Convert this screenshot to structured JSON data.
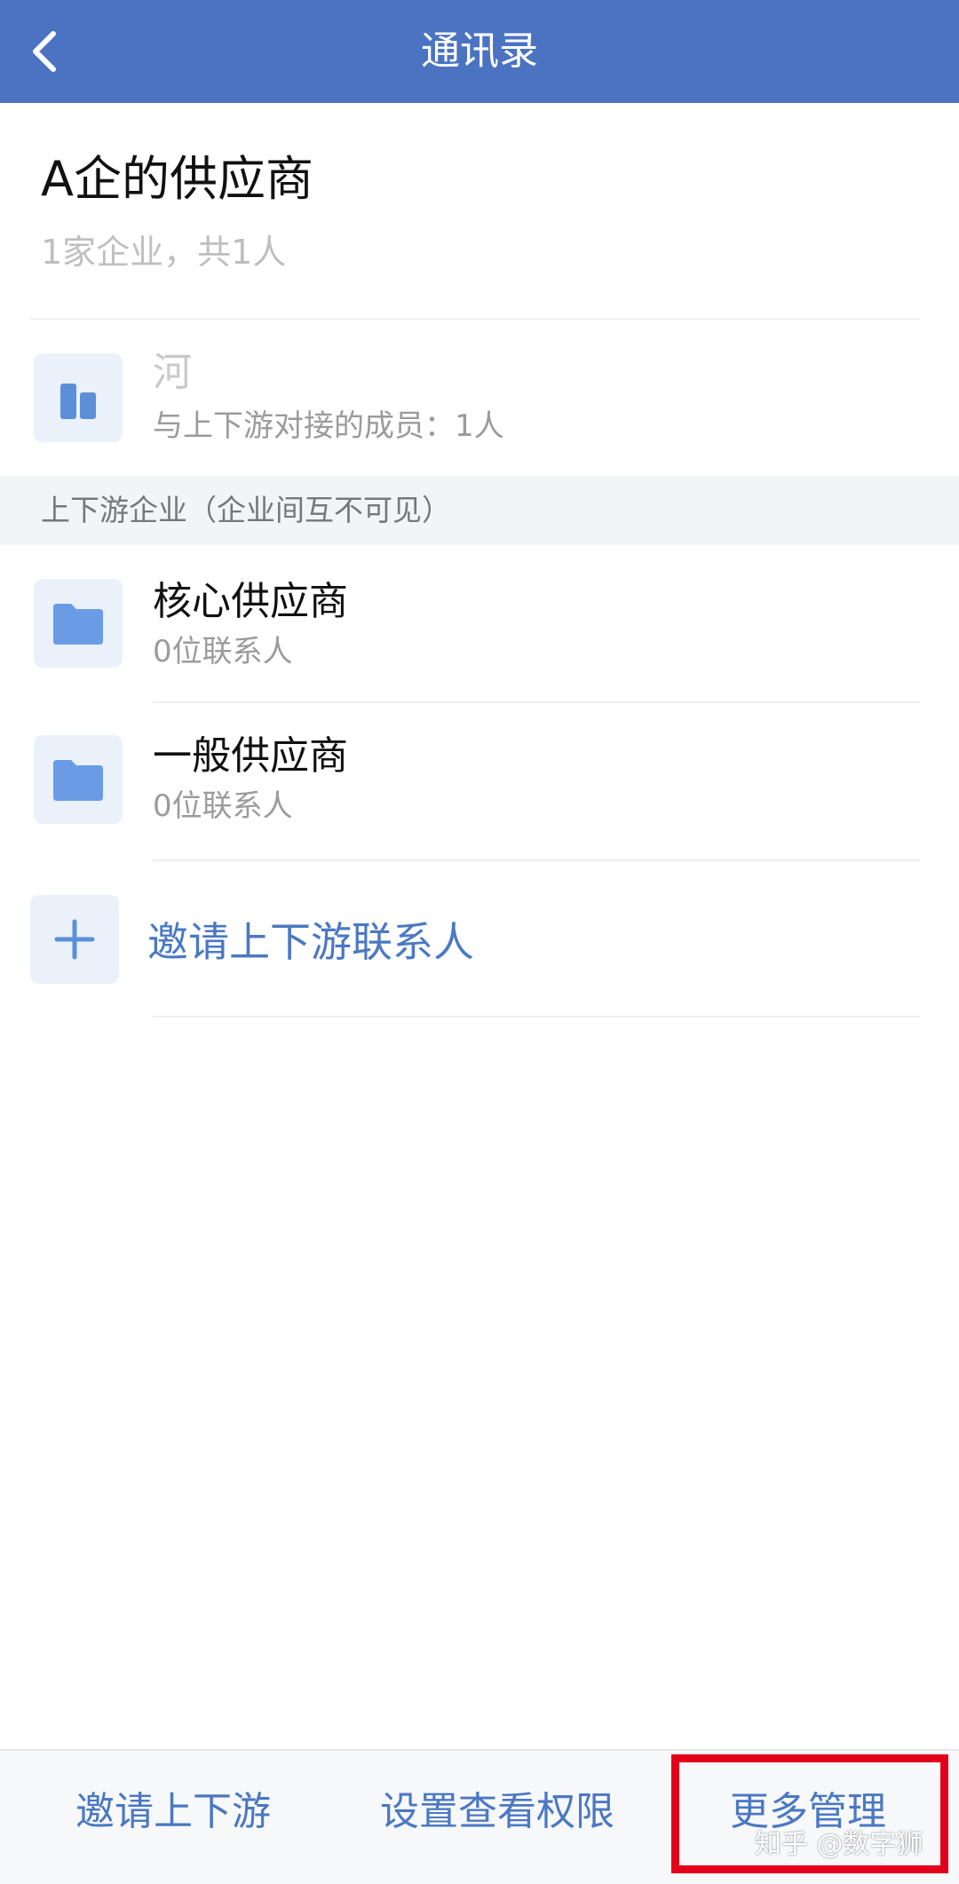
{
  "header": {
    "title": "通讯录",
    "back_icon": "chevron-left-icon"
  },
  "group": {
    "name": "A企的供应商",
    "summary": "1家企业，共1人"
  },
  "my_company": {
    "icon": "building-icon",
    "name": "河",
    "members_line": "与上下游对接的成员：1人"
  },
  "section": {
    "label": "上下游企业（企业间互不可见）"
  },
  "folders": [
    {
      "icon": "folder-icon",
      "name": "核心供应商",
      "count": "0位联系人"
    },
    {
      "icon": "folder-icon",
      "name": "一般供应商",
      "count": "0位联系人"
    }
  ],
  "invite": {
    "icon": "plus-icon",
    "label": "邀请上下游联系人"
  },
  "bottom_bar": {
    "invite": "邀请上下游",
    "permissions": "设置查看权限",
    "more": "更多管理"
  },
  "watermark": "知乎 @数字狮",
  "colors": {
    "header_bg": "#4b73c1",
    "accent": "#4a78c3",
    "highlight": "#e3001b"
  }
}
